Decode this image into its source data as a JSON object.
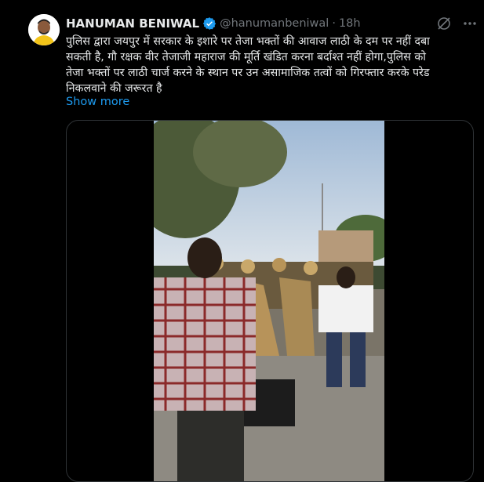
{
  "tweet": {
    "author_name": "HANUMAN BENIWAL",
    "handle": "@hanumanbeniwal",
    "separator": "·",
    "time": "18h",
    "verified": true,
    "text": "पुलिस द्वारा जयपुर में सरकार के इशारे पर तेजा भक्तों की आवाज लाठी के दम पर नहीं दबा\nसकती है, गौ रक्षक वीर तेजाजी महाराज की मूर्ति खंडित करना बर्दाश्त नहीं होगा,पुलिस को\nतेजा भक्तों पर लाठी चार्ज करने के स्थान पर उन असामाजिक तत्वों को गिरफ्तार करके परेड\nनिकलवाने की जरूरत है",
    "show_more_label": "Show more"
  },
  "icons": {
    "verified": "verified-badge-icon",
    "grok": "grok-icon",
    "more": "more-options-icon"
  },
  "colors": {
    "background": "#000000",
    "text": "#e7e9ea",
    "muted": "#71767b",
    "accent": "#1d9bf0",
    "border": "#2f3336"
  }
}
